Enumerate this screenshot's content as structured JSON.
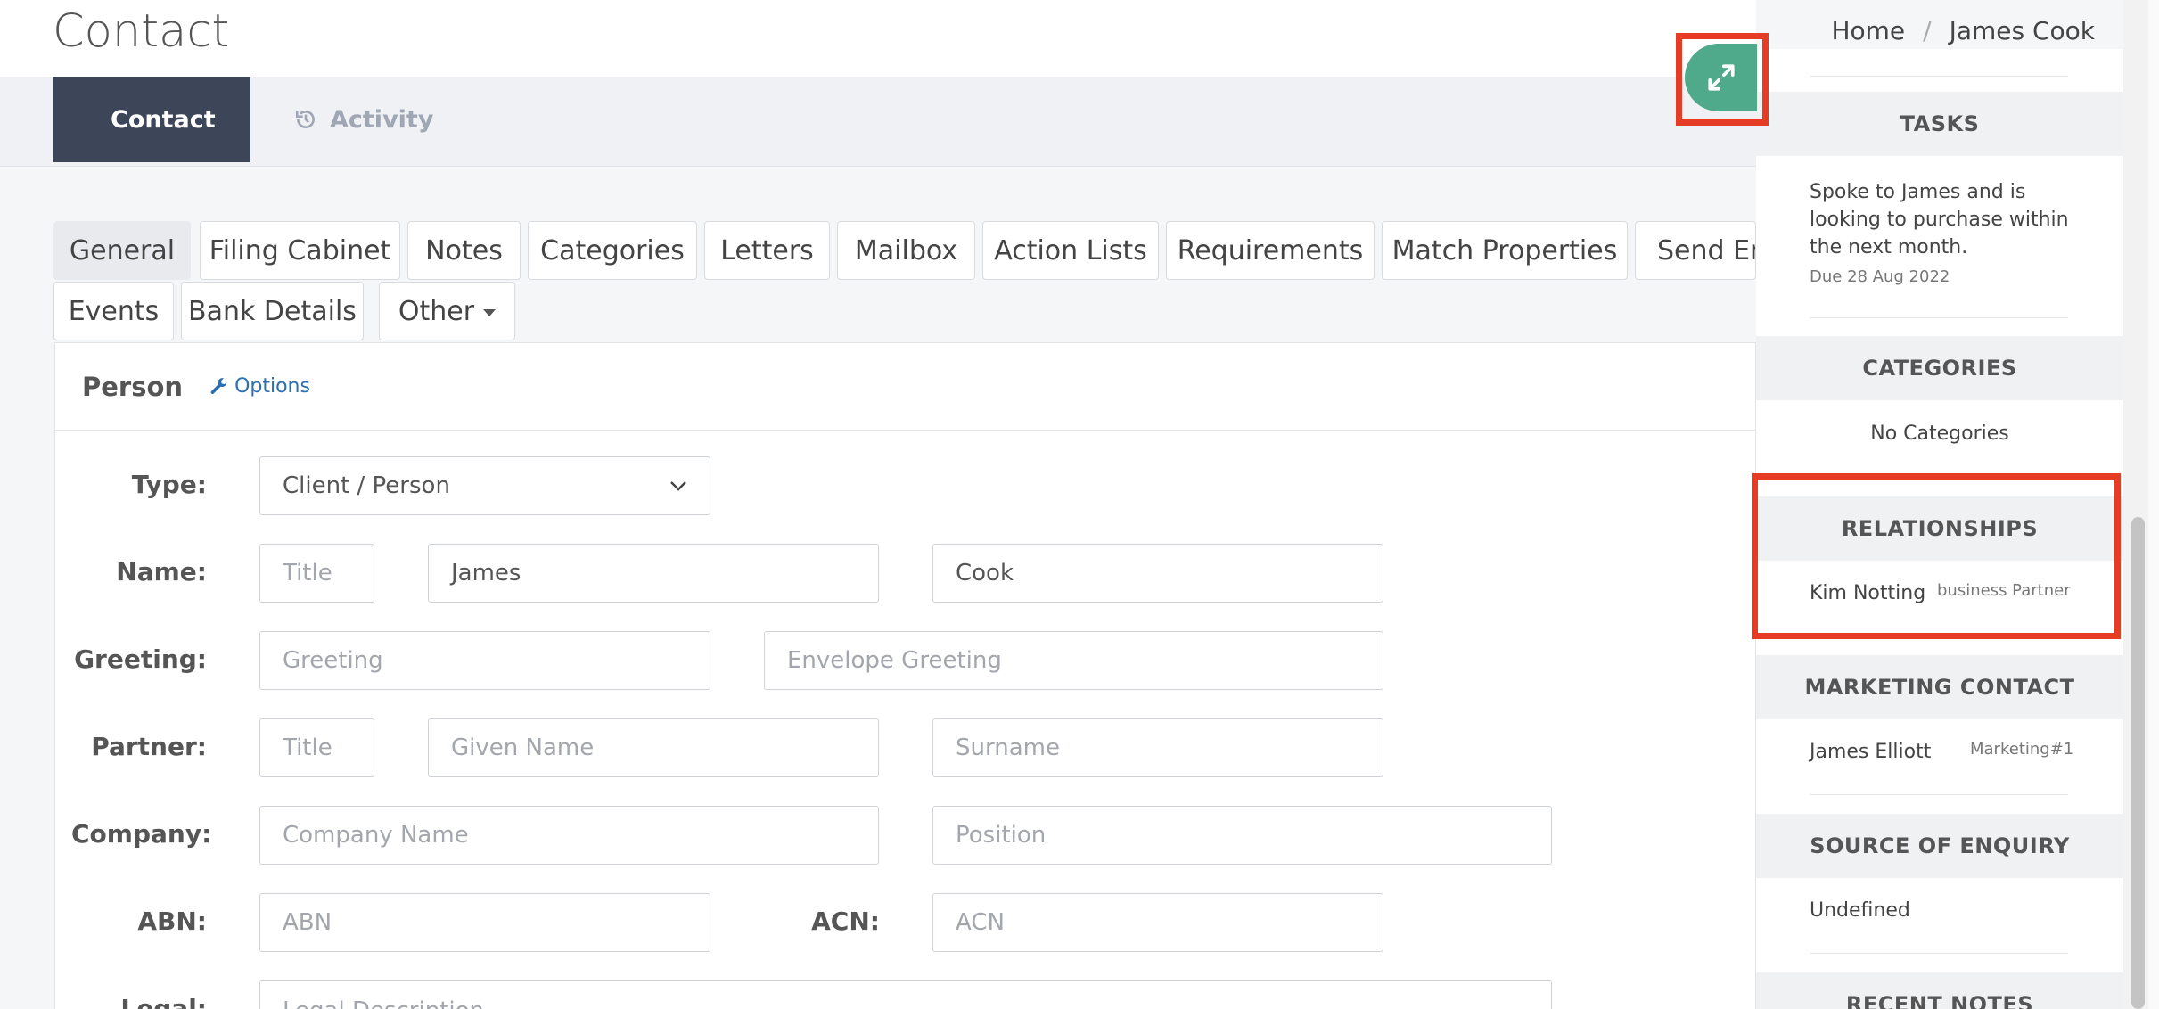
{
  "page": {
    "title": "Contact"
  },
  "breadcrumb": {
    "home": "Home",
    "separator": "/",
    "current": "James Cook"
  },
  "main_tabs": {
    "contact": "Contact",
    "activity": "Activity"
  },
  "sub_tabs": [
    "General",
    "Filing Cabinet",
    "Notes",
    "Categories",
    "Letters",
    "Mailbox",
    "Action Lists",
    "Requirements",
    "Match Properties",
    "Send Em",
    "Events",
    "Bank Details",
    "Other"
  ],
  "panel": {
    "title": "Person",
    "options": "Options"
  },
  "form": {
    "labels": {
      "type": "Type:",
      "name": "Name:",
      "greeting": "Greeting:",
      "partner": "Partner:",
      "company": "Company:",
      "abn": "ABN:",
      "acn": "ACN:",
      "legal": "Legal:"
    },
    "type_value": "Client / Person",
    "name_title_placeholder": "Title",
    "name_first": "James",
    "name_last": "Cook",
    "greeting_placeholder": "Greeting",
    "envelope_greeting_placeholder": "Envelope Greeting",
    "partner_title_placeholder": "Title",
    "partner_given_placeholder": "Given Name",
    "partner_surname_placeholder": "Surname",
    "company_placeholder": "Company Name",
    "position_placeholder": "Position",
    "abn_placeholder": "ABN",
    "acn_placeholder": "ACN",
    "legal_placeholder": "Legal Description"
  },
  "sidebar": {
    "tasks": {
      "heading": "TASKS",
      "text_line1": "Spoke to James and is",
      "text_line2": "looking to purchase within",
      "text_line3": "the next month.",
      "due": "Due 28 Aug 2022"
    },
    "categories": {
      "heading": "CATEGORIES",
      "empty": "No Categories"
    },
    "relationships": {
      "heading": "RELATIONSHIPS",
      "name": "Kim Notting",
      "type": "business Partner"
    },
    "marketing": {
      "heading": "MARKETING CONTACT",
      "name": "James Elliott",
      "tag": "Marketing#1"
    },
    "source": {
      "heading": "SOURCE OF ENQUIRY",
      "value": "Undefined"
    },
    "notes": {
      "heading": "RECENT NOTES"
    }
  },
  "colors": {
    "accent": "#4eaa8a",
    "highlight": "#e63b24",
    "tab_active": "#3c4658",
    "link": "#2a6fb2"
  },
  "icons": {
    "contact": "user-icon",
    "activity": "history-icon",
    "options": "wrench-icon",
    "expand": "expand-arrows-icon"
  }
}
